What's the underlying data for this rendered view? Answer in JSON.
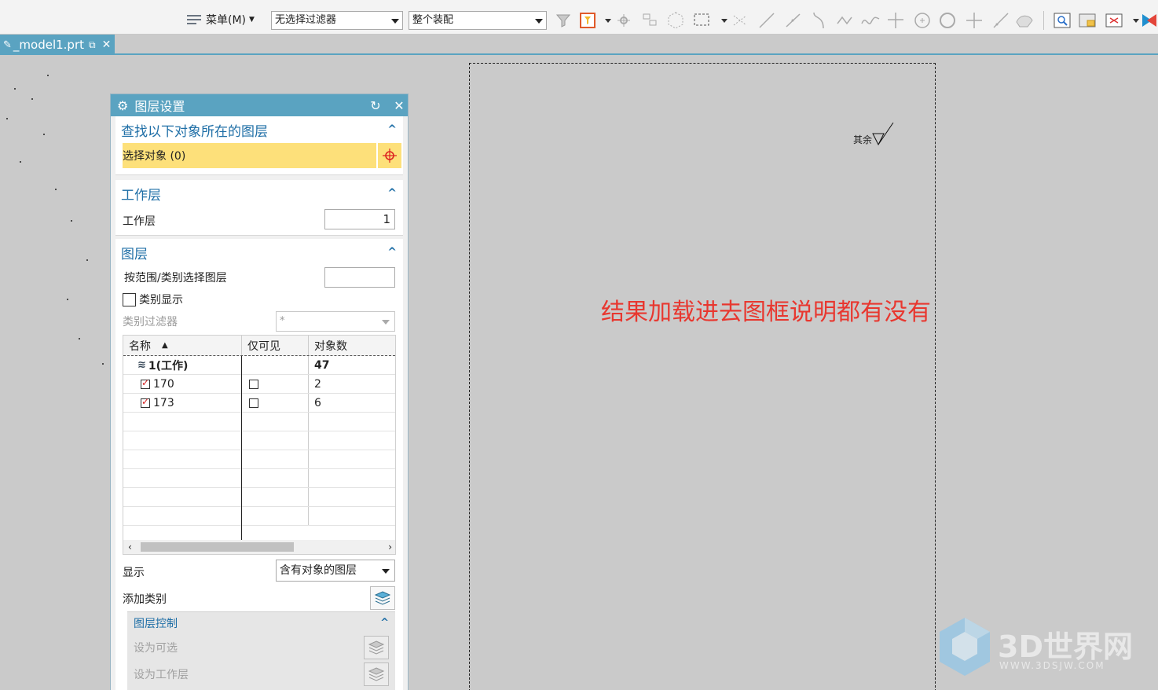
{
  "toolbar": {
    "menu_label": "菜单(M)",
    "filter_value": "无选择过滤器",
    "assembly_value": "整个装配"
  },
  "tab": {
    "file_name": "_model1.prt"
  },
  "canvas": {
    "annotation": "结果加载进去图框说明都有没有",
    "symbol_text": "其余"
  },
  "dialog": {
    "title": "图层设置",
    "find_section": {
      "header": "查找以下对象所在的图层",
      "select_object": "选择对象 (0)"
    },
    "work_layer_section": {
      "header": "工作层",
      "label": "工作层",
      "value": "1"
    },
    "layers_section": {
      "header": "图层",
      "range_label": "按范围/类别选择图层",
      "category_display": "类别显示",
      "category_filter_label": "类别过滤器",
      "category_filter_value": "*",
      "columns": [
        "名称",
        "仅可见",
        "对象数"
      ],
      "rows": [
        {
          "name": "1(工作)",
          "count": "47"
        },
        {
          "name": "170",
          "count": "2"
        },
        {
          "name": "173",
          "count": "6"
        }
      ],
      "display_label": "显示",
      "display_value": "含有对象的图层",
      "add_category": "添加类别"
    },
    "layer_control": {
      "header": "图层控制",
      "set_selectable": "设为可选",
      "set_work": "设为工作层"
    }
  },
  "watermark": {
    "brand": "3D世界网",
    "url": "WWW.3DSJW.COM"
  }
}
